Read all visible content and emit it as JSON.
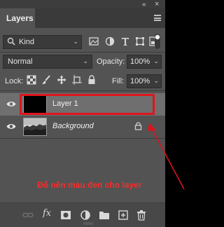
{
  "panel": {
    "tab_label": "Layers",
    "collapse_glyph": "«",
    "close_glyph": "×"
  },
  "filter": {
    "kind_label": "Kind",
    "filter_icons": [
      "image-filter-icon",
      "adjustment-filter-icon",
      "type-filter-icon",
      "shape-filter-icon",
      "smart-object-filter-icon"
    ]
  },
  "blend": {
    "mode": "Normal",
    "opacity_label": "Opacity:",
    "opacity_value": "100%"
  },
  "lock": {
    "label": "Lock:",
    "fill_label": "Fill:",
    "fill_value": "100%",
    "icons": [
      "lock-transparent-icon",
      "lock-image-icon",
      "lock-position-icon",
      "lock-artboard-icon",
      "lock-all-icon"
    ]
  },
  "layers": [
    {
      "name": "Layer 1",
      "selected": true,
      "thumbnail": "black"
    },
    {
      "name": "Background",
      "selected": false,
      "thumbnail": "photo",
      "locked": true
    }
  ],
  "annotation": {
    "text": "Đổ nền màu đen cho layer",
    "color": "#ff2a2a"
  },
  "bottom_icons": [
    "link-layers-icon",
    "fx-icon",
    "add-mask-icon",
    "adjustment-layer-icon",
    "new-group-icon",
    "new-layer-icon",
    "delete-layer-icon"
  ],
  "bottom_fx_label": "fx",
  "colors": {
    "panel_bg": "#535353",
    "selected_row": "#6f6f6f",
    "highlight_red": "#e0141c"
  }
}
